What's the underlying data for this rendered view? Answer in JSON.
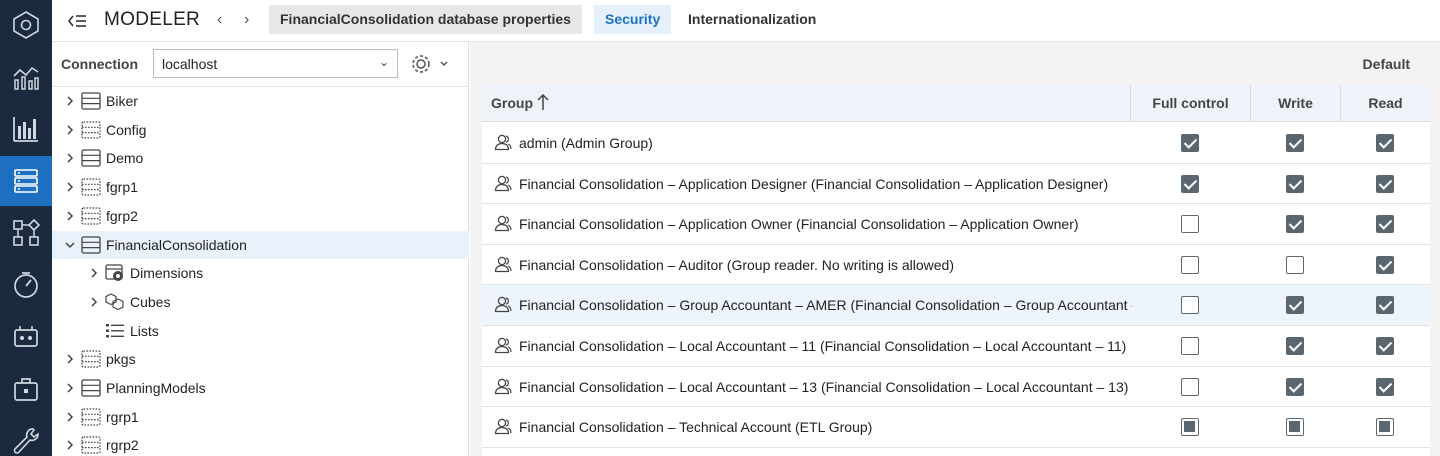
{
  "app": {
    "title": "MODELER"
  },
  "tabs": [
    {
      "label": "FinancialConsolidation database properties",
      "state": "grey"
    },
    {
      "label": "Security",
      "state": "active"
    },
    {
      "label": "Internationalization",
      "state": "normal"
    }
  ],
  "rail": {
    "items": [
      "hexagon-icon",
      "analytics-icon",
      "report-icon",
      "database-icon",
      "flow-icon",
      "gauge-icon",
      "agent-icon",
      "briefcase-icon",
      "wrench-icon"
    ],
    "active_index": 3
  },
  "connection": {
    "label": "Connection",
    "value": "localhost"
  },
  "tree": [
    {
      "label": "Biker",
      "type": "db",
      "level": 0,
      "chevron": "right"
    },
    {
      "label": "Config",
      "type": "db-dotted",
      "level": 0,
      "chevron": "right"
    },
    {
      "label": "Demo",
      "type": "db",
      "level": 0,
      "chevron": "right"
    },
    {
      "label": "fgrp1",
      "type": "db-dotted",
      "level": 0,
      "chevron": "right"
    },
    {
      "label": "fgrp2",
      "type": "db-dotted",
      "level": 0,
      "chevron": "right"
    },
    {
      "label": "FinancialConsolidation",
      "type": "db",
      "level": 0,
      "chevron": "down",
      "selected": true
    },
    {
      "label": "Dimensions",
      "type": "dimensions",
      "level": 1,
      "chevron": "right"
    },
    {
      "label": "Cubes",
      "type": "cubes",
      "level": 1,
      "chevron": "right"
    },
    {
      "label": "Lists",
      "type": "lists",
      "level": 1,
      "chevron": "none"
    },
    {
      "label": "pkgs",
      "type": "db-dotted",
      "level": 0,
      "chevron": "right"
    },
    {
      "label": "PlanningModels",
      "type": "db",
      "level": 0,
      "chevron": "right"
    },
    {
      "label": "rgrp1",
      "type": "db-dotted",
      "level": 0,
      "chevron": "right"
    },
    {
      "label": "rgrp2",
      "type": "db-dotted",
      "level": 0,
      "chevron": "right"
    }
  ],
  "security": {
    "default_label": "Default",
    "columns": {
      "group": "Group",
      "full_control": "Full control",
      "write": "Write",
      "read": "Read"
    },
    "rows": [
      {
        "group": "admin (Admin Group)",
        "full": "checked",
        "write": "checked",
        "read": "checked"
      },
      {
        "group": "Financial Consolidation – Application Designer (Financial Consolidation – Application Designer)",
        "full": "checked",
        "write": "checked",
        "read": "checked"
      },
      {
        "group": "Financial Consolidation – Application Owner (Financial Consolidation – Application Owner)",
        "full": "unchecked",
        "write": "checked",
        "read": "checked"
      },
      {
        "group": "Financial Consolidation – Auditor (Group reader. No writing is allowed)",
        "full": "unchecked",
        "write": "unchecked",
        "read": "checked"
      },
      {
        "group": "Financial Consolidation – Group Accountant – AMER (Financial Consolidation – Group Accountant – AMER)",
        "full": "unchecked",
        "write": "checked",
        "read": "checked",
        "highlighted": true
      },
      {
        "group": "Financial Consolidation – Local Accountant – 11 (Financial Consolidation – Local Accountant – 11)",
        "full": "unchecked",
        "write": "checked",
        "read": "checked"
      },
      {
        "group": "Financial Consolidation – Local Accountant – 13 (Financial Consolidation – Local Accountant – 13)",
        "full": "unchecked",
        "write": "checked",
        "read": "checked"
      },
      {
        "group": "Financial Consolidation – Technical Account (ETL Group)",
        "full": "partial",
        "write": "partial",
        "read": "partial"
      }
    ]
  },
  "colors": {
    "rail_bg": "#1b2b3d",
    "rail_active": "#1e6fc0",
    "accent": "#1a73c4"
  }
}
